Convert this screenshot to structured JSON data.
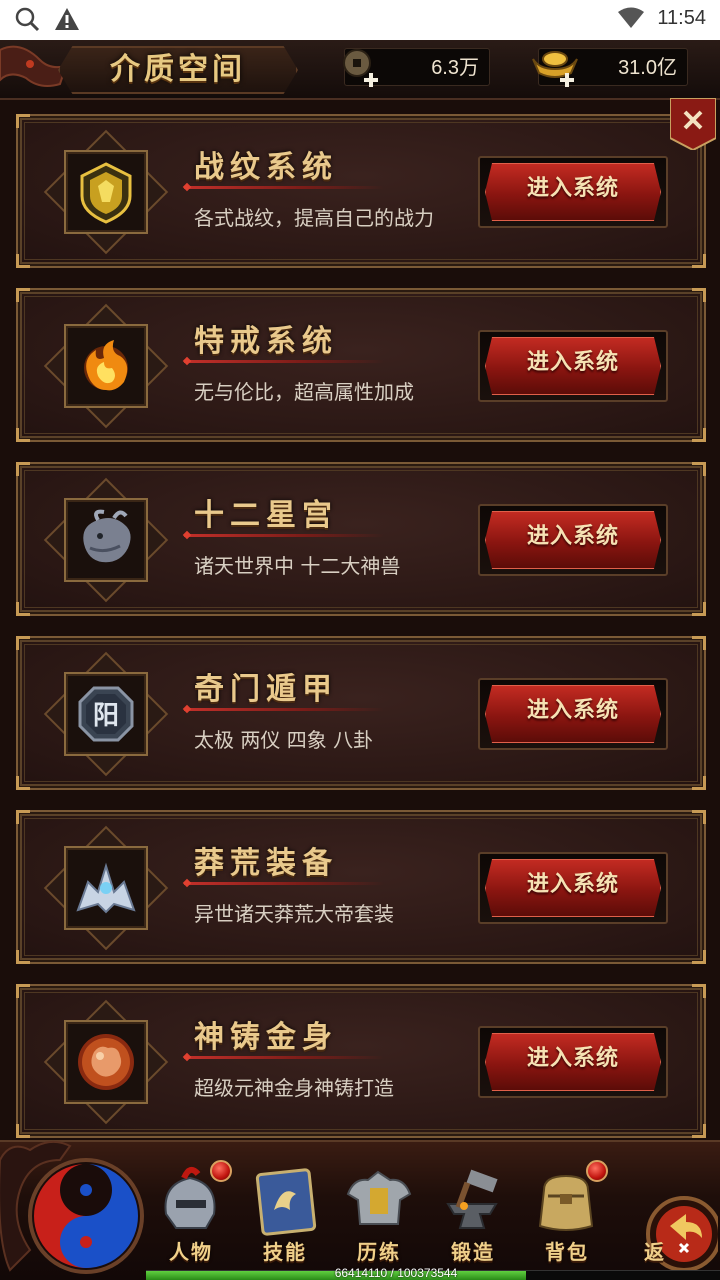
{
  "status_bar": {
    "time": "11:54"
  },
  "header": {
    "title": "介质空间",
    "copper": {
      "value": "6.3万",
      "icon": "coin-add-icon"
    },
    "gold": {
      "value": "31.0亿",
      "icon": "gold-ingot-add-icon"
    }
  },
  "cards": [
    {
      "title": "战纹系统",
      "desc": "各式战纹，提高自己的战力",
      "button": "进入系统",
      "icon": "shield-emblem-icon"
    },
    {
      "title": "特戒系统",
      "desc": "无与伦比，超高属性加成",
      "button": "进入系统",
      "icon": "fire-ring-icon"
    },
    {
      "title": "十二星宫",
      "desc": "诸天世界中 十二大神兽",
      "button": "进入系统",
      "icon": "dragon-head-icon"
    },
    {
      "title": "奇门遁甲",
      "desc": "太极 两仪 四象 八卦",
      "button": "进入系统",
      "icon": "yang-badge-icon",
      "badge_text": "阳"
    },
    {
      "title": "莽荒装备",
      "desc": "异世诸天莽荒大帝套装",
      "button": "进入系统",
      "icon": "silver-armor-icon"
    },
    {
      "title": "神铸金身",
      "desc": "超级元神金身神铸打造",
      "button": "进入系统",
      "icon": "golden-body-orb-icon"
    }
  ],
  "bottom_nav": {
    "items": [
      {
        "label": "人物",
        "icon": "warrior-helmet-icon",
        "has_dot": true
      },
      {
        "label": "技能",
        "icon": "skill-book-icon",
        "has_dot": false
      },
      {
        "label": "历练",
        "icon": "armor-icon",
        "has_dot": false
      },
      {
        "label": "锻造",
        "icon": "anvil-hammer-icon",
        "has_dot": false
      },
      {
        "label": "背包",
        "icon": "bag-icon",
        "has_dot": true
      }
    ],
    "return_label": "返",
    "exp_text": "66414110 / 100373544",
    "exp_fraction": 0.662
  },
  "colors": {
    "title_gold": "#e9c98c",
    "button_red": "#c32b22",
    "card_border": "#7b5a36"
  }
}
